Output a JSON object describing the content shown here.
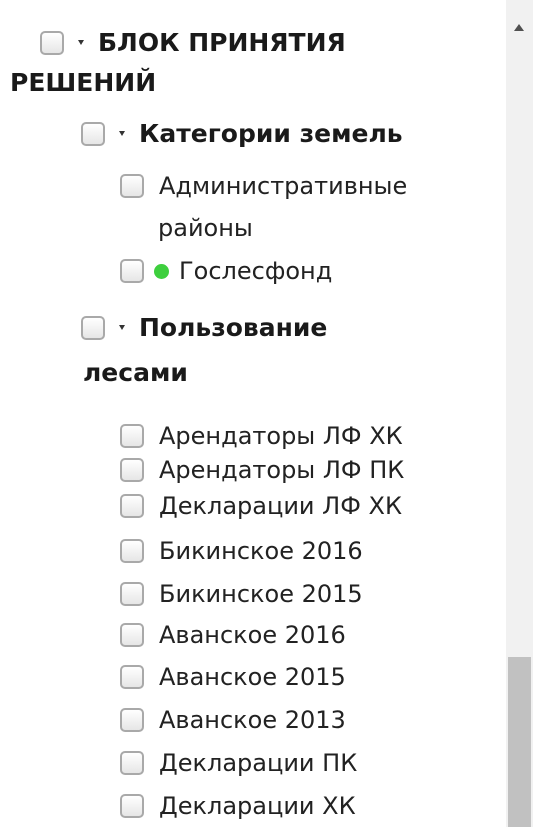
{
  "tree": {
    "root": {
      "label_line1": "БЛОК ПРИНЯТИЯ",
      "label_line2": "РЕШЕНИЙ"
    },
    "groups": [
      {
        "label": "Категории земель",
        "items": [
          {
            "label_line1": "Административные",
            "label_line2": "районы"
          },
          {
            "label": "Гослесфонд",
            "indicator_color": "#3ecf3e"
          }
        ]
      },
      {
        "label_line1": "Пользование",
        "label_line2": "лесами",
        "items": [
          {
            "label": "Арендаторы ЛФ ХК"
          },
          {
            "label": "Арендаторы ЛФ ПК"
          },
          {
            "label": "Декларации ЛФ ХК"
          },
          {
            "label": "Бикинское 2016"
          },
          {
            "label": "Бикинское 2015"
          },
          {
            "label": "Аванское 2016"
          },
          {
            "label": "Аванское 2015"
          },
          {
            "label": "Аванское 2013"
          },
          {
            "label": "Декларации ПК"
          },
          {
            "label": "Декларации ХК"
          }
        ]
      }
    ]
  }
}
